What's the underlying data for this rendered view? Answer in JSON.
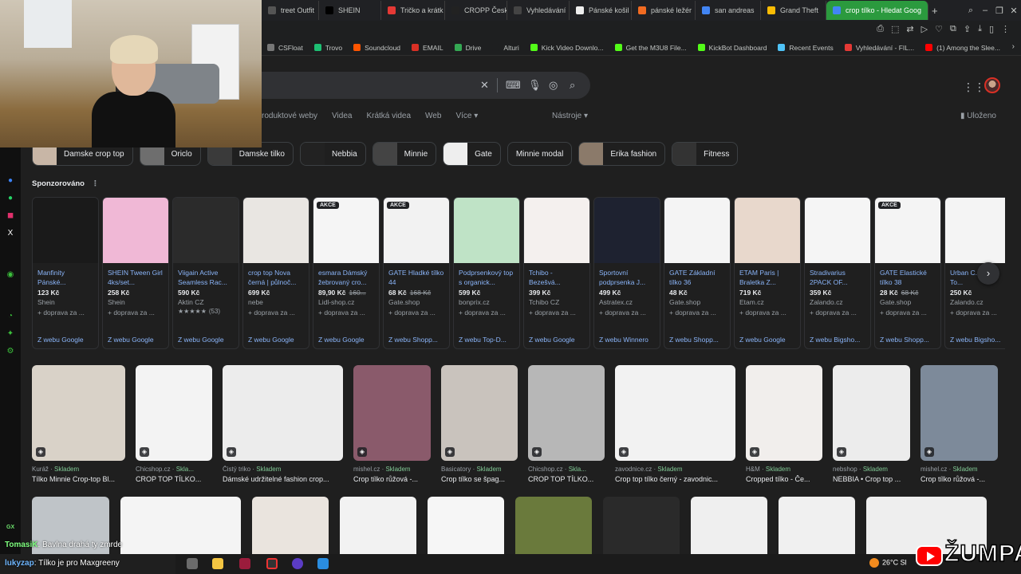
{
  "browser": {
    "tabs": [
      {
        "label": "treet Outfit",
        "color": "#555"
      },
      {
        "label": "SHEIN",
        "color": "#000"
      },
      {
        "label": "Tričko a krátk",
        "color": "#e53935"
      },
      {
        "label": "CROPP Česk",
        "color": "#222"
      },
      {
        "label": "Vyhledávání",
        "color": "#444"
      },
      {
        "label": "Pánské košil",
        "color": "#eee"
      },
      {
        "label": "pánské ležér",
        "color": "#f26b21"
      },
      {
        "label": "san andreas",
        "color": "#4285f4"
      },
      {
        "label": "Grand Theft",
        "color": "#fbbc04"
      },
      {
        "label": "crop tílko - Hledat Goog",
        "color": "#4285f4",
        "active": true
      }
    ],
    "new_tab": "+"
  },
  "bookmarks": [
    {
      "label": "CSFloat",
      "color": "#777"
    },
    {
      "label": "Trovo",
      "color": "#1dbf73"
    },
    {
      "label": "Soundcloud",
      "color": "#ff5500"
    },
    {
      "label": "EMAIL",
      "color": "#d93025"
    },
    {
      "label": "Drive",
      "color": "#34a853"
    },
    {
      "label": "Alturi",
      "color": "#1e1f20"
    },
    {
      "label": "Kick Video Downlo...",
      "color": "#53fc18"
    },
    {
      "label": "Get the M3U8 File...",
      "color": "#53fc18"
    },
    {
      "label": "KickBot Dashboard",
      "color": "#53fc18"
    },
    {
      "label": "Recent Events",
      "color": "#4fc3f7"
    },
    {
      "label": "Vyhledávání - FIL...",
      "color": "#e53935"
    },
    {
      "label": "(1) Among the Slee...",
      "color": "#ff0000"
    }
  ],
  "search": {
    "nav_tabs": [
      "roduktové weby",
      "Videa",
      "Krátká videa",
      "Web",
      "Více"
    ],
    "tools": "Nástroje",
    "saved": "Uloženo"
  },
  "chips": [
    {
      "label": "Damske crop top",
      "thumb": "#c8b6a6"
    },
    {
      "label": "Oriclo",
      "thumb": "#6e6e6e"
    },
    {
      "label": "Damske tilko",
      "thumb": "#3a3a3a"
    },
    {
      "label": "Nebbia",
      "thumb": "#222"
    },
    {
      "label": "Minnie",
      "thumb": "#444"
    },
    {
      "label": "Gate",
      "thumb": "#eeeeee"
    },
    {
      "label": "Minnie modal",
      "thumb": null
    },
    {
      "label": "Erika fashion",
      "thumb": "#8b7a6a"
    },
    {
      "label": "Fitness",
      "thumb": "#333"
    }
  ],
  "sponsored_label": "Sponzorováno",
  "products": [
    {
      "title": "Manfinity Pánské...",
      "price": "123 Kč",
      "old": "",
      "merchant": "Shein",
      "delivery": "+ doprava za ...",
      "from": "Z webu Google",
      "rating": "",
      "reviews": "",
      "badge": "",
      "img": "#1a1a1a"
    },
    {
      "title": "SHEIN Tween Girl 4ks/set...",
      "price": "258 Kč",
      "old": "",
      "merchant": "Shein",
      "delivery": "+ doprava za ...",
      "from": "Z webu Google",
      "rating": "",
      "reviews": "",
      "badge": "",
      "img": "#f0b8d6"
    },
    {
      "title": "Viigain Active Seamless Rac...",
      "price": "590 Kč",
      "old": "",
      "merchant": "Aktin CZ",
      "delivery": "+ doprava za ...",
      "from": "Z webu Google",
      "rating": "★★★★★",
      "reviews": "(53)",
      "badge": "",
      "img": "#2b2b2b"
    },
    {
      "title": "crop top Nova černá | půlnoč...",
      "price": "699 Kč",
      "old": "",
      "merchant": "nebe",
      "delivery": "+ doprava za ...",
      "from": "Z webu Google",
      "rating": "",
      "reviews": "",
      "badge": "",
      "img": "#e9e6e2"
    },
    {
      "title": "esmara Dámský žebrovaný cro...",
      "price": "89,90 Kč",
      "old": "160...",
      "merchant": "Lidl-shop.cz",
      "delivery": "+ doprava za ...",
      "from": "Z webu Google",
      "rating": "",
      "reviews": "",
      "badge": "AKCE",
      "img": "#f5f5f5"
    },
    {
      "title": "GATE Hladké tílko 44",
      "price": "68 Kč",
      "old": "168 Kč",
      "merchant": "Gate.shop",
      "delivery": "+ doprava za ...",
      "from": "Z webu Shopp...",
      "rating": "",
      "reviews": "",
      "badge": "AKCE",
      "img": "#f2f2f2"
    },
    {
      "title": "Podprsenkový top s organick...",
      "price": "599 Kč",
      "old": "",
      "merchant": "bonprix.cz",
      "delivery": "+ doprava za ...",
      "from": "Z webu Top-D...",
      "rating": "",
      "reviews": "",
      "badge": "",
      "img": "#bfe3c6"
    },
    {
      "title": "Tchibo - Bezešvá...",
      "price": "399 Kč",
      "old": "",
      "merchant": "Tchibo CZ",
      "delivery": "+ doprava za ...",
      "from": "Z webu Google",
      "rating": "",
      "reviews": "",
      "badge": "",
      "img": "#f4f0ee"
    },
    {
      "title": "Sportovní podprsenka J...",
      "price": "499 Kč",
      "old": "",
      "merchant": "Astratex.cz",
      "delivery": "+ doprava za ...",
      "from": "Z webu Winnero",
      "rating": "",
      "reviews": "",
      "badge": "",
      "img": "#1e2230"
    },
    {
      "title": "GATE Základní tílko 36",
      "price": "48 Kč",
      "old": "",
      "merchant": "Gate.shop",
      "delivery": "+ doprava za ...",
      "from": "Z webu Shopp...",
      "rating": "",
      "reviews": "",
      "badge": "",
      "img": "#f4f4f4"
    },
    {
      "title": "ETAM Paris | Braletka Z...",
      "price": "719 Kč",
      "old": "",
      "merchant": "Etam.cz",
      "delivery": "+ doprava za ...",
      "from": "Z webu Google",
      "rating": "",
      "reviews": "",
      "badge": "",
      "img": "#e8d8cc"
    },
    {
      "title": "Stradivarius 2PACK OF...",
      "price": "359 Kč",
      "old": "",
      "merchant": "Zalando.cz",
      "delivery": "+ doprava za ...",
      "from": "Z webu Bigsho...",
      "rating": "",
      "reviews": "",
      "badge": "",
      "img": "#f5f5f5"
    },
    {
      "title": "GATE Elastické tílko 38",
      "price": "28 Kč",
      "old": "68 Kč",
      "merchant": "Gate.shop",
      "delivery": "+ doprava za ...",
      "from": "Z webu Shopp...",
      "rating": "",
      "reviews": "",
      "badge": "AKCE",
      "img": "#f4f4f4"
    },
    {
      "title": "Urban C... Short To...",
      "price": "250 Kč",
      "old": "",
      "merchant": "Zalando.cz",
      "delivery": "+ doprava za ...",
      "from": "Z webu Bigsho...",
      "rating": "",
      "reviews": "",
      "badge": "",
      "img": "#f4f4f4"
    }
  ],
  "next_arrow": "›",
  "images": [
    {
      "source": "Kuráž",
      "stock": "Skladem",
      "caption": "Tílko Minnie Crop-top Bl...",
      "color": "#d9d2c8"
    },
    {
      "source": "Chicshop.cz",
      "stock": "Skla...",
      "caption": "CROP TOP TÍLKO...",
      "color": "#f3f3f3"
    },
    {
      "source": "Čistý triko",
      "stock": "Skladem",
      "caption": "Dámské udržitelné fashion crop...",
      "color": "#ececec"
    },
    {
      "source": "mishel.cz",
      "stock": "Skladem",
      "caption": "Crop tílko růžová -...",
      "color": "#8a5a6b"
    },
    {
      "source": "Basicatory",
      "stock": "Skladem",
      "caption": "Crop tílko se špag...",
      "color": "#c9c3bd"
    },
    {
      "source": "Chicshop.cz",
      "stock": "Skla...",
      "caption": "CROP TOP TÍLKO...",
      "color": "#b7b7b7"
    },
    {
      "source": "zavodnice.cz",
      "stock": "Skladem",
      "caption": "Crop top tílko černý - zavodnic...",
      "color": "#f2f2f2"
    },
    {
      "source": "H&M",
      "stock": "Skladem",
      "caption": "Cropped tílko - Če...",
      "color": "#f1eeec"
    },
    {
      "source": "nebshop",
      "stock": "Skladem",
      "caption": "NEBBIA • Crop top ...",
      "color": "#ececec"
    },
    {
      "source": "mishel.cz",
      "stock": "Skladem",
      "caption": "Crop tílko růžová -...",
      "color": "#7d8a9a"
    }
  ],
  "images_row2_colors": [
    "#bfc4c8",
    "#f4f4f4",
    "#eae4de",
    "#f2f2f2",
    "#f6f6f6",
    "#6a7a3c",
    "#2a2a2a",
    "#efefef",
    "#f0f0f0",
    "#eeeeee"
  ],
  "chat": {
    "line1_name": "TomasiK",
    "line1_text": ": Bavlna drahá ty zmrde",
    "line2_name": "lukyzap",
    "line2_text": ": Tílko je pro Maxgreeny",
    "gx": "GX"
  },
  "taskbar": {
    "weather": "26°C  Sl"
  },
  "logo_text": "ŽUMPA"
}
